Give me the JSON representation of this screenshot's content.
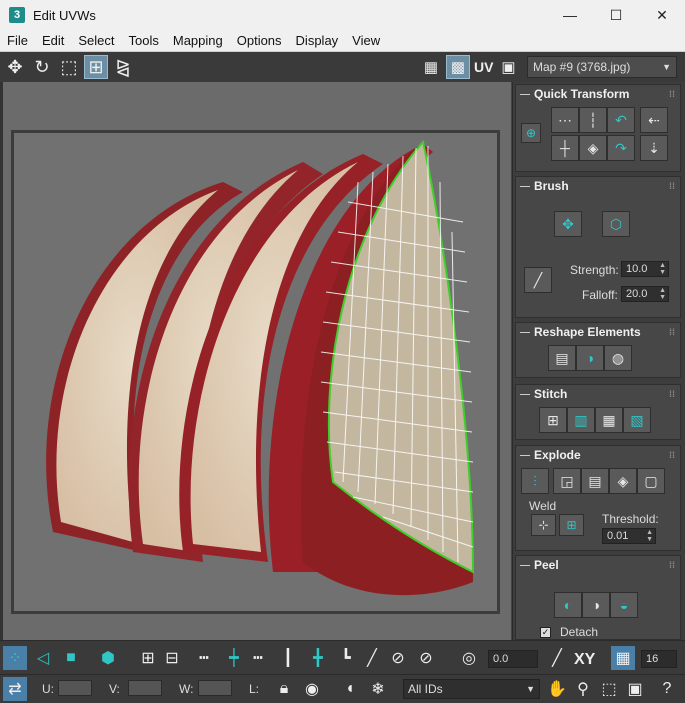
{
  "window": {
    "app_icon": "3",
    "title": "Edit UVWs",
    "minimize": "—",
    "maximize": "☐",
    "close": "✕"
  },
  "menu": [
    "File",
    "Edit",
    "Select",
    "Tools",
    "Mapping",
    "Options",
    "Display",
    "View"
  ],
  "toolbar": {
    "uv_label": "UV",
    "map_select": "Map #9 (3768.jpg)"
  },
  "panels": {
    "quick_transform": "Quick Transform",
    "brush": {
      "title": "Brush",
      "strength_label": "Strength:",
      "strength_value": "10.0",
      "falloff_label": "Falloff:",
      "falloff_value": "20.0"
    },
    "reshape": "Reshape Elements",
    "stitch": "Stitch",
    "explode": {
      "title": "Explode",
      "weld_label": "Weld",
      "threshold_label": "Threshold:",
      "threshold_value": "0.01"
    },
    "peel": {
      "title": "Peel",
      "detach_label": "Detach"
    }
  },
  "bottom1": {
    "angle_value": "0.0",
    "xy_label": "XY",
    "grid_value": "16"
  },
  "bottom2": {
    "u_label": "U:",
    "v_label": "V:",
    "w_label": "W:",
    "l_label": "L:",
    "ids_select": "All IDs"
  },
  "colors": {
    "accent": "#31c6c6",
    "seam": "#3ecf2a",
    "apple_red": "#8c1f22",
    "apple_flesh": "#e8d6c0"
  }
}
